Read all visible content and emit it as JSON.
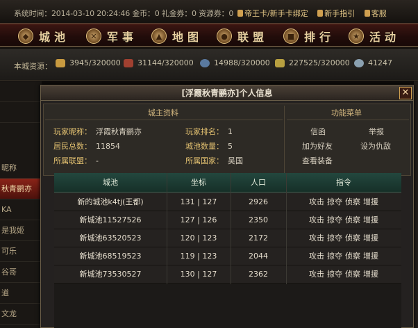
{
  "status": {
    "time_label": "系统时间：",
    "time_value": "2014-03-10 20:24:46",
    "gold": "金币：0",
    "coupon": "礼金券：0",
    "res_coupon": "资源券：0",
    "links": [
      "帝王卡/新手卡绑定",
      "新手指引",
      "客服"
    ]
  },
  "nav": {
    "items": [
      {
        "label": "城池",
        "icon": "castle-icon"
      },
      {
        "label": "军事",
        "icon": "sword-icon"
      },
      {
        "label": "地图",
        "icon": "map-icon"
      },
      {
        "label": "联盟",
        "icon": "alliance-icon"
      },
      {
        "label": "排行",
        "icon": "ranking-icon"
      },
      {
        "label": "活动",
        "icon": "activity-icon"
      }
    ]
  },
  "resources": {
    "label": "本城资源：",
    "items": [
      {
        "name": "food",
        "value": "3945/320000",
        "color": "#c89a40"
      },
      {
        "name": "wood",
        "value": "31144/320000",
        "color": "#a04030"
      },
      {
        "name": "stone",
        "value": "14988/320000",
        "color": "#5a7aa0"
      },
      {
        "name": "iron",
        "value": "227525/320000",
        "color": "#b8a040"
      },
      {
        "name": "population",
        "value": "41247",
        "color": "#8aa0b0"
      }
    ]
  },
  "bg_list": [
    "",
    "",
    "昵称",
    "秋青鹂亦",
    "KA",
    "是我姬",
    "可乐",
    "谷哥",
    "道",
    "文龙"
  ],
  "modal": {
    "title": "[浮霞秋青鹂亦]个人信息",
    "close": "✕",
    "lord_header": "城主资料",
    "func_header": "功能菜单",
    "fields": {
      "nickname_k": "玩家昵称：",
      "nickname_v": "浮霞秋青鹂亦",
      "rank_k": "玩家排名：",
      "rank_v": "1",
      "residents_k": "居民总数：",
      "residents_v": "11854",
      "cities_k": "城池数量：",
      "cities_v": "5",
      "alliance_k": "所属联盟：",
      "alliance_v": "-",
      "country_k": "所属国家：",
      "country_v": "吴国"
    },
    "functions": [
      "信函",
      "举报",
      "加为好友",
      "设为仇敌",
      "查看装备"
    ]
  },
  "city_table": {
    "headers": [
      "城池",
      "坐标",
      "人口",
      "指令"
    ],
    "actions": [
      "攻击",
      "掠夺",
      "侦察",
      "增援"
    ],
    "rows": [
      {
        "name": "新的城池k4tj(王都)",
        "x": "131",
        "y": "127",
        "pop": "2926"
      },
      {
        "name": "新城池11527526",
        "x": "127",
        "y": "126",
        "pop": "2350"
      },
      {
        "name": "新城池63520523",
        "x": "120",
        "y": "123",
        "pop": "2172"
      },
      {
        "name": "新城池68519523",
        "x": "119",
        "y": "123",
        "pop": "2044"
      },
      {
        "name": "新城池73530527",
        "x": "130",
        "y": "127",
        "pop": "2362"
      }
    ],
    "coord_sep": "|"
  }
}
